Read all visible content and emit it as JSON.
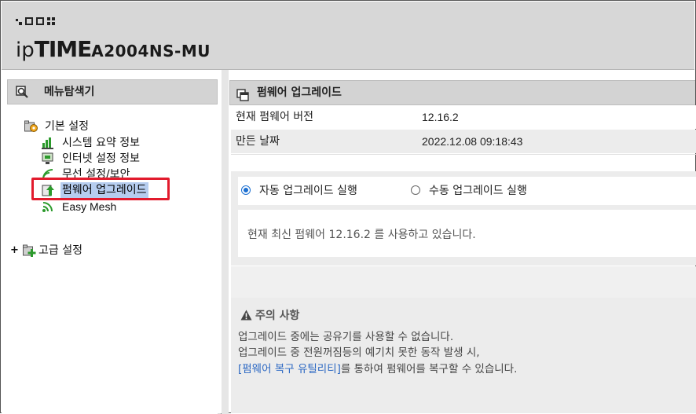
{
  "header": {
    "logo_brand_prefix": "ip",
    "logo_brand_main": "TIME",
    "model": "A2004NS-MU"
  },
  "menu": {
    "title": "메뉴탐색기",
    "basic": {
      "label": "기본 설정",
      "items": [
        {
          "label": "시스템 요약 정보"
        },
        {
          "label": "인터넷 설정 정보"
        },
        {
          "label": "무선 설정/보안"
        },
        {
          "label": "펌웨어 업그레이드"
        },
        {
          "label": "Easy Mesh"
        }
      ]
    },
    "advanced": {
      "expander": "+",
      "label": "고급 설정"
    }
  },
  "content": {
    "title": "펌웨어 업그레이드",
    "current_version_label": "현재 펌웨어 버전",
    "current_version_value": "12.16.2",
    "build_date_label": "만든 날짜",
    "build_date_value": "2022.12.08 09:18:43",
    "auto_upgrade_label": "자동 업그레이드 실행",
    "manual_upgrade_label": "수동 업그레이드 실행",
    "status_message": "현재 최신 펌웨어 12.16.2 를 사용하고 있습니다.",
    "notice": {
      "title": "주의 사항",
      "line1": "업그레이드 중에는 공유기를 사용할 수 없습니다.",
      "line2": "업그레이드 중 전원꺼짐등의 예기치 못한 동작 발생 시,",
      "line3_link": "[펌웨어 복구 유틸리티]",
      "line3_rest": "를 통하여 펌웨어를 복구할 수 있습니다."
    }
  },
  "colors": {
    "header_bg": "#d7d7d7",
    "selection": "#b6cdef",
    "highlight_box": "#e21b2d",
    "radio_accent": "#1b6fd1",
    "link": "#2c68c3"
  }
}
